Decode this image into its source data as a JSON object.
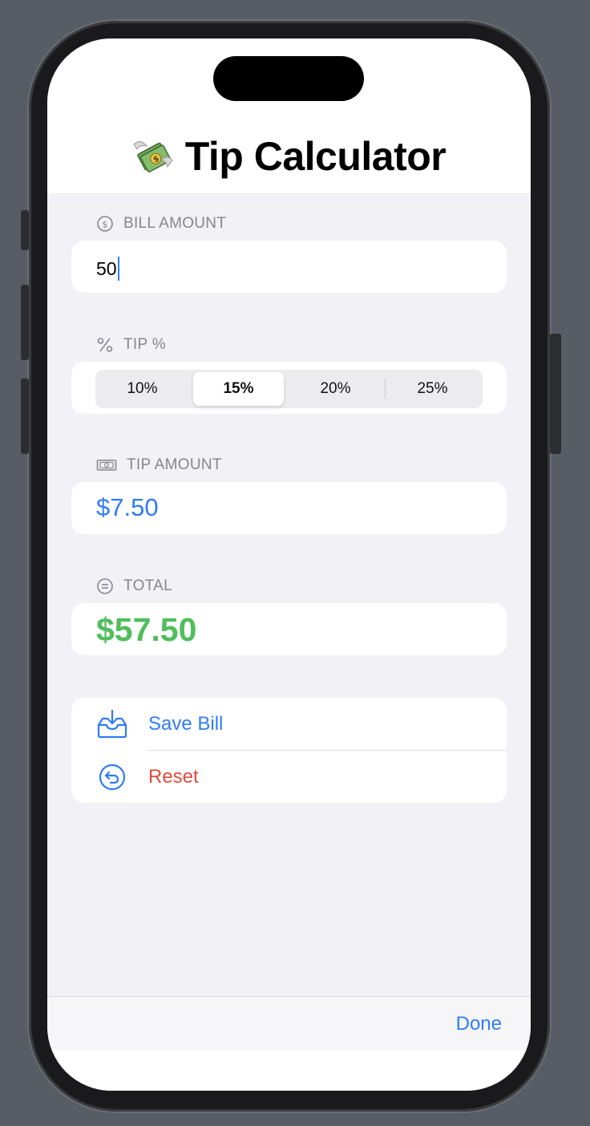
{
  "app": {
    "title": "Tip Calculator",
    "title_icon": "money-with-wings-emoji"
  },
  "bill": {
    "label": "BILL AMOUNT",
    "icon": "dollar-circle-icon",
    "value": "50"
  },
  "tip_percent": {
    "label": "TIP %",
    "icon": "percent-icon",
    "options": [
      "10%",
      "15%",
      "20%",
      "25%"
    ],
    "selected": "15%"
  },
  "tip_amount": {
    "label": "TIP AMOUNT",
    "icon": "banknote-icon",
    "value": "$7.50"
  },
  "total": {
    "label": "TOTAL",
    "icon": "equal-circle-icon",
    "value": "$57.50"
  },
  "actions": {
    "save_label": "Save Bill",
    "save_icon": "tray-download-icon",
    "reset_label": "Reset",
    "reset_icon": "undo-circle-icon"
  },
  "toolbar": {
    "done_label": "Done"
  },
  "colors": {
    "accent": "#2f7cf6",
    "total_green": "#4fbe5b",
    "reset_red": "#e04a3c",
    "background": "#f1f1f6"
  }
}
